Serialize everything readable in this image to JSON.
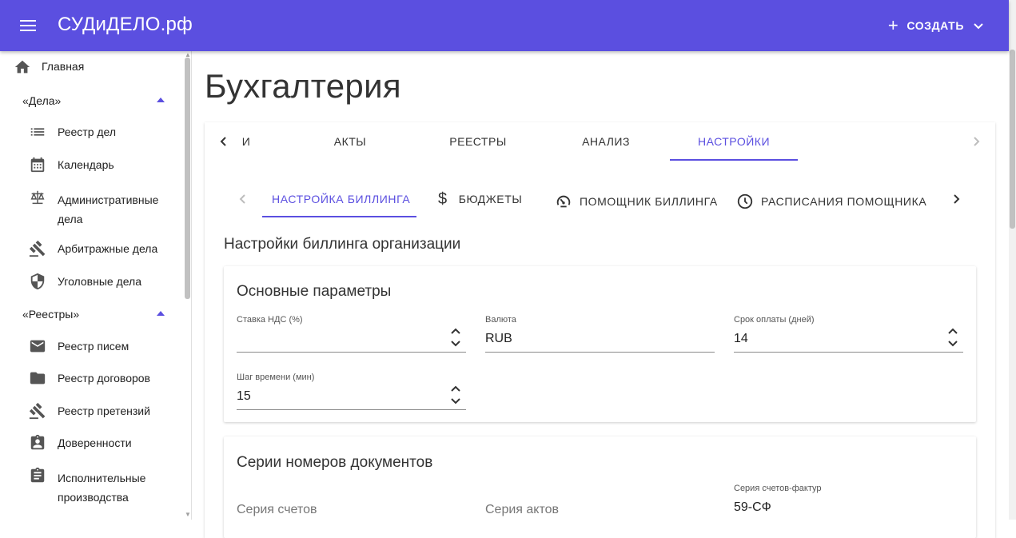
{
  "app": {
    "title": "СУДиДЕЛО.рф",
    "create_label": "СОЗДАТЬ",
    "accent": "#5b4fe0"
  },
  "sidebar": {
    "home": "Главная",
    "group_cases": "«Дела»",
    "cases": [
      {
        "icon": "list-icon",
        "label": "Реестр дел"
      },
      {
        "icon": "calendar-icon",
        "label": "Календарь"
      },
      {
        "icon": "scales-icon",
        "label": "Административные дела"
      },
      {
        "icon": "gavel-icon",
        "label": "Арбитражные дела"
      },
      {
        "icon": "shield-icon",
        "label": "Уголовные дела"
      }
    ],
    "group_registers": "«Реестры»",
    "registers": [
      {
        "icon": "mail-icon",
        "label": "Реестр писем"
      },
      {
        "icon": "folder-icon",
        "label": "Реестр договоров"
      },
      {
        "icon": "gavel-icon",
        "label": "Реестр претензий"
      },
      {
        "icon": "badge-icon",
        "label": "Доверенности"
      },
      {
        "icon": "clipboard-icon",
        "label": "Исполнительные производства"
      }
    ]
  },
  "page": {
    "title": "Бухгалтерия"
  },
  "tabs": [
    "И",
    "АКТЫ",
    "РЕЕСТРЫ",
    "АНАЛИЗ",
    "НАСТРОЙКИ"
  ],
  "active_tab": "НАСТРОЙКИ",
  "subtabs": [
    {
      "icon": "",
      "label": "НАСТРОЙКА БИЛЛИНГА"
    },
    {
      "icon": "dollar-icon",
      "label": "БЮДЖЕТЫ"
    },
    {
      "icon": "speedometer-icon",
      "label": "ПОМОЩНИК БИЛЛИНГА"
    },
    {
      "icon": "clock-icon",
      "label": "РАСПИСАНИЯ ПОМОЩНИКА"
    }
  ],
  "billing": {
    "section_title": "Настройки биллинга организации",
    "basic": {
      "title": "Основные параметры",
      "vat_label": "Ставка НДС (%)",
      "vat_value": "",
      "currency_label": "Валюта",
      "currency_value": "RUB",
      "payment_term_label": "Срок оплаты (дней)",
      "payment_term_value": "14",
      "time_step_label": "Шаг времени (мин)",
      "time_step_value": "15"
    },
    "series": {
      "title": "Серии номеров документов",
      "invoices_placeholder": "Серия счетов",
      "acts_placeholder": "Серия актов",
      "vat_invoice_label": "Серия счетов-фактур",
      "vat_invoice_value": "59-СФ"
    }
  }
}
